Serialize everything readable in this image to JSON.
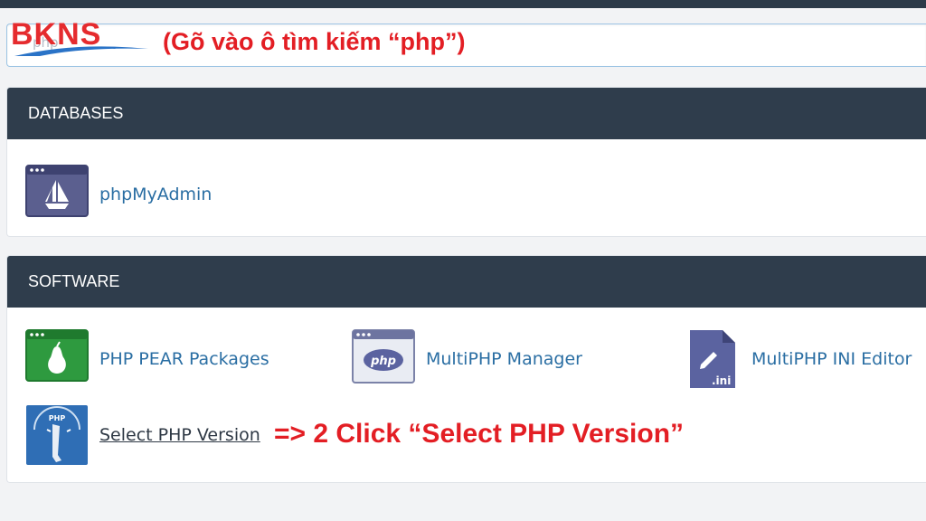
{
  "brand": {
    "logo_text": "BKNS"
  },
  "search": {
    "faint_text": "php"
  },
  "annotations": {
    "step1": "(Gõ vào ô tìm kiếm “php”)",
    "step2": "=> 2 Click “Select PHP Version”"
  },
  "databases": {
    "header": "DATABASES",
    "items": [
      {
        "label": "phpMyAdmin",
        "icon": "phpmyadmin-icon"
      }
    ]
  },
  "software": {
    "header": "SOFTWARE",
    "items": [
      {
        "label": "PHP PEAR Packages",
        "icon": "pear-icon"
      },
      {
        "label": "MultiPHP Manager",
        "icon": "php-window-icon"
      },
      {
        "label": "MultiPHP INI Editor",
        "icon": "ini-file-icon"
      },
      {
        "label": "Select PHP Version",
        "icon": "php-gauge-icon"
      }
    ]
  },
  "colors": {
    "header_bg": "#2f3d4c",
    "link": "#2a6ea3",
    "annotation_red": "#e31e24",
    "search_border": "#9cc4e4"
  }
}
